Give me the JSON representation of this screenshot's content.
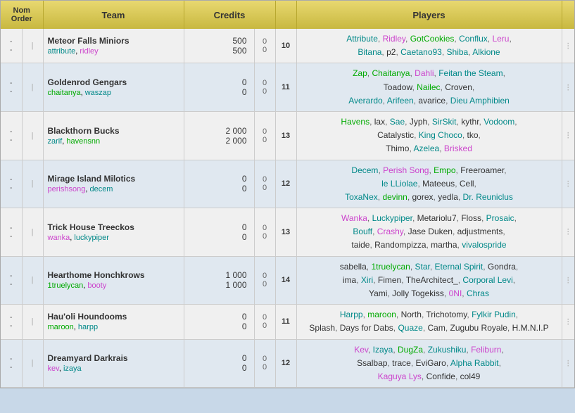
{
  "header": {
    "col_order": "Nom\nOrder",
    "col_team": "Team",
    "col_credits": "Credits",
    "col_players": "Players"
  },
  "rows": [
    {
      "order": "-\n-",
      "team_name": "Meteor Falls Miniors",
      "captains": [
        {
          "name": "attribute",
          "color": "c-teal"
        },
        {
          "name": "ridley",
          "color": "c-pink"
        }
      ],
      "credits_top": "500",
      "credits_bot": "500",
      "credits_sub": "0",
      "player_count": "10",
      "players": [
        {
          "name": "Attribute",
          "color": "c-teal",
          "sep": true
        },
        {
          "name": "Ridley",
          "color": "c-pink",
          "sep": true
        },
        {
          "name": "GotCookies",
          "color": "c-green",
          "sep": true
        },
        {
          "name": "Conflux",
          "color": "c-teal",
          "sep": true
        },
        {
          "name": "Leru",
          "color": "c-pink",
          "sep": false
        },
        {
          "name": "Bitana",
          "color": "c-teal",
          "sep": true
        },
        {
          "name": "p2",
          "color": "c-dark",
          "sep": true
        },
        {
          "name": "Caetano93",
          "color": "c-teal",
          "sep": true
        },
        {
          "name": "Shiba",
          "color": "c-teal",
          "sep": true
        },
        {
          "name": "Alkione",
          "color": "c-teal",
          "sep": false
        }
      ],
      "players_line1": "Attribute, Ridley, GotCookies, Conflux, Leru,",
      "players_line2": "Bitana, p2, Caetano93, Shiba, Alkione"
    },
    {
      "order": "-\n-",
      "team_name": "Goldenrod Gengars",
      "captains": [
        {
          "name": "chaitanya",
          "color": "c-green"
        },
        {
          "name": "waszap",
          "color": "c-teal"
        }
      ],
      "credits_top": "0",
      "credits_bot": "0",
      "credits_sub": "0",
      "player_count": "11",
      "players_line1": "Zap, Chaitanya, Dahli, Feitan the Steam,",
      "players_line2": "Toadow, Nailec, Croven, Averardo, Arifeen,",
      "players_line3": "avarice, Dieu Amphibien"
    },
    {
      "order": "-\n-",
      "team_name": "Blackthorn Bucks",
      "captains": [
        {
          "name": "zarif",
          "color": "c-teal"
        },
        {
          "name": "havensnn",
          "color": "c-green"
        }
      ],
      "credits_top": "2 000",
      "credits_bot": "2 000",
      "credits_sub": "0",
      "player_count": "13",
      "players_line1": "Havens, lax, Sae, Jyph, SirSkit, kythr, Vodoom,",
      "players_line2": "Catalystic, King Choco, tko, Thimo, Azelea,",
      "players_line3": "Brisked"
    },
    {
      "order": "-\n-",
      "team_name": "Mirage Island Milotics",
      "captains": [
        {
          "name": "perishsong",
          "color": "c-pink"
        },
        {
          "name": "decem",
          "color": "c-teal"
        }
      ],
      "credits_top": "0",
      "credits_bot": "0",
      "credits_sub": "0",
      "player_count": "12",
      "players_line1": "Decem, Perish Song, Empo, Freeroamer,",
      "players_line2": "le LLiolae, Mateeus, Cell, ToxaNex, devinn, gorex,",
      "players_line3": "yedla, Dr. Reuniclus"
    },
    {
      "order": "-\n-",
      "team_name": "Trick House Treeckos",
      "captains": [
        {
          "name": "wanka",
          "color": "c-pink"
        },
        {
          "name": "luckypiper",
          "color": "c-teal"
        }
      ],
      "credits_top": "0",
      "credits_bot": "0",
      "credits_sub": "0",
      "player_count": "13",
      "players_line1": "Wanka, Luckypiper, Metariolu7, Floss, Prosaic,",
      "players_line2": "Bouff, Crashy, Jase Duken, adjustments, taide,",
      "players_line3": "Randompizza, martha, vivalospride"
    },
    {
      "order": "-\n-",
      "team_name": "Hearthome Honchkrows",
      "captains": [
        {
          "name": "1truelycan",
          "color": "c-green"
        },
        {
          "name": "booty",
          "color": "c-pink"
        }
      ],
      "credits_top": "1 000",
      "credits_bot": "1 000",
      "credits_sub": "0",
      "player_count": "14",
      "players_line1": "sabella, 1truelycan, Star, Eternal Spirit, Gondra,",
      "players_line2": "ima, Xiri, Fimen, TheArchitect_, Corporal Levi,",
      "players_line3": "Yami, Jolly Togekiss, 0NI, Chras"
    },
    {
      "order": "-\n-",
      "team_name": "Hau'oli Houndooms",
      "captains": [
        {
          "name": "maroon",
          "color": "c-green"
        },
        {
          "name": "harpp",
          "color": "c-teal"
        }
      ],
      "credits_top": "0",
      "credits_bot": "0",
      "credits_sub": "0",
      "player_count": "11",
      "players_line1": "Harpp, maroon, North, Trichotomy, Fylkir Pudin,",
      "players_line2": "Splash, Days for Dabs, Quaze, Cam,",
      "players_line3": "Zugubu Royale, H.M.N.I.P"
    },
    {
      "order": "-\n-",
      "team_name": "Dreamyard Darkrais",
      "captains": [
        {
          "name": "kev",
          "color": "c-pink"
        },
        {
          "name": "izaya",
          "color": "c-teal"
        }
      ],
      "credits_top": "0",
      "credits_bot": "0",
      "credits_sub": "0",
      "player_count": "12",
      "players_line1": "Kev, Izaya, DugZa, Zukushiku, Feliburn,",
      "players_line2": "Ssalbap, trace, EviGaro, Alpha Rabbit, Kaguya Lys,",
      "players_line3": "Confide, col49"
    }
  ]
}
